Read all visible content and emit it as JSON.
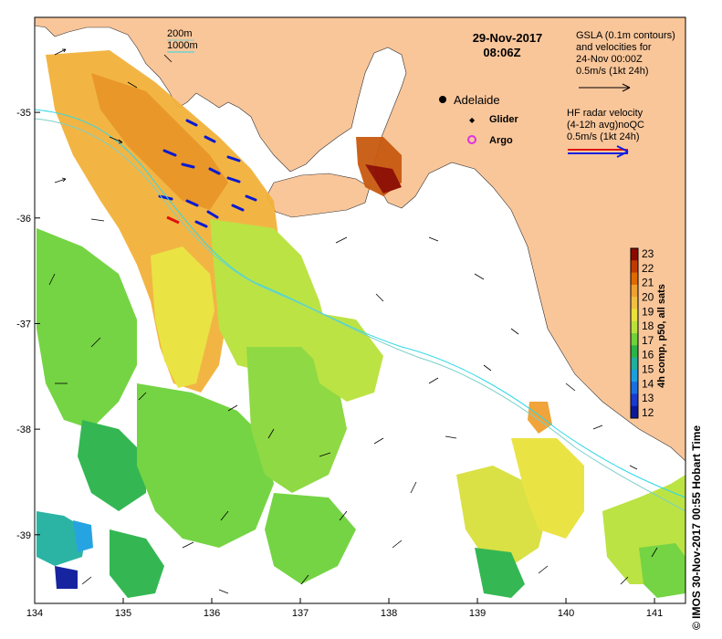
{
  "map": {
    "date": "29-Nov-2017",
    "time": "08:06Z",
    "colorbar_title": "4h comp, p50, all sats",
    "colorbar_ticks": [
      "23",
      "22",
      "21",
      "20",
      "19",
      "18",
      "17",
      "16",
      "15",
      "14",
      "13",
      "12"
    ],
    "colorbar_colors": [
      "#8b0a00",
      "#c23a00",
      "#e06a00",
      "#f0a030",
      "#f2c040",
      "#e9e23a",
      "#b8e23a",
      "#6ed23a",
      "#2ab44a",
      "#20b0a0",
      "#1aa0e0",
      "#1a6ee0",
      "#1a3ad0",
      "#0a1a9a"
    ],
    "x_ticks": [
      "134",
      "135",
      "136",
      "137",
      "138",
      "139",
      "140",
      "141"
    ],
    "y_ticks": [
      "-35",
      "-36",
      "-37",
      "-38",
      "-39"
    ],
    "lon_range": [
      134,
      141.35
    ],
    "lat_range": [
      -39.65,
      -34.1
    ],
    "bathy_legend": {
      "line1": "200m",
      "line2": "1000m"
    },
    "places": {
      "city": "Adelaide",
      "glider": "Glider",
      "argo": "Argo"
    },
    "gsla": {
      "line1": "GSLA (0.1m contours)",
      "line2": "and velocities for",
      "line3": "24-Nov 00:00Z",
      "line4": "0.5m/s (1kt 24h)"
    },
    "hf_radar": {
      "line1": "HF radar velocity",
      "line2": "(4-12h avg)noQC",
      "line3": "0.5m/s (1kt 24h)"
    },
    "credit": "© IMOS 30-Nov-2017 00:55 Hobart Time",
    "colors": {
      "land": "#f9c69a",
      "ocean": "#ffffff",
      "bathy_200": "#7ad0c8",
      "bathy_1000": "#30d8e8"
    }
  }
}
